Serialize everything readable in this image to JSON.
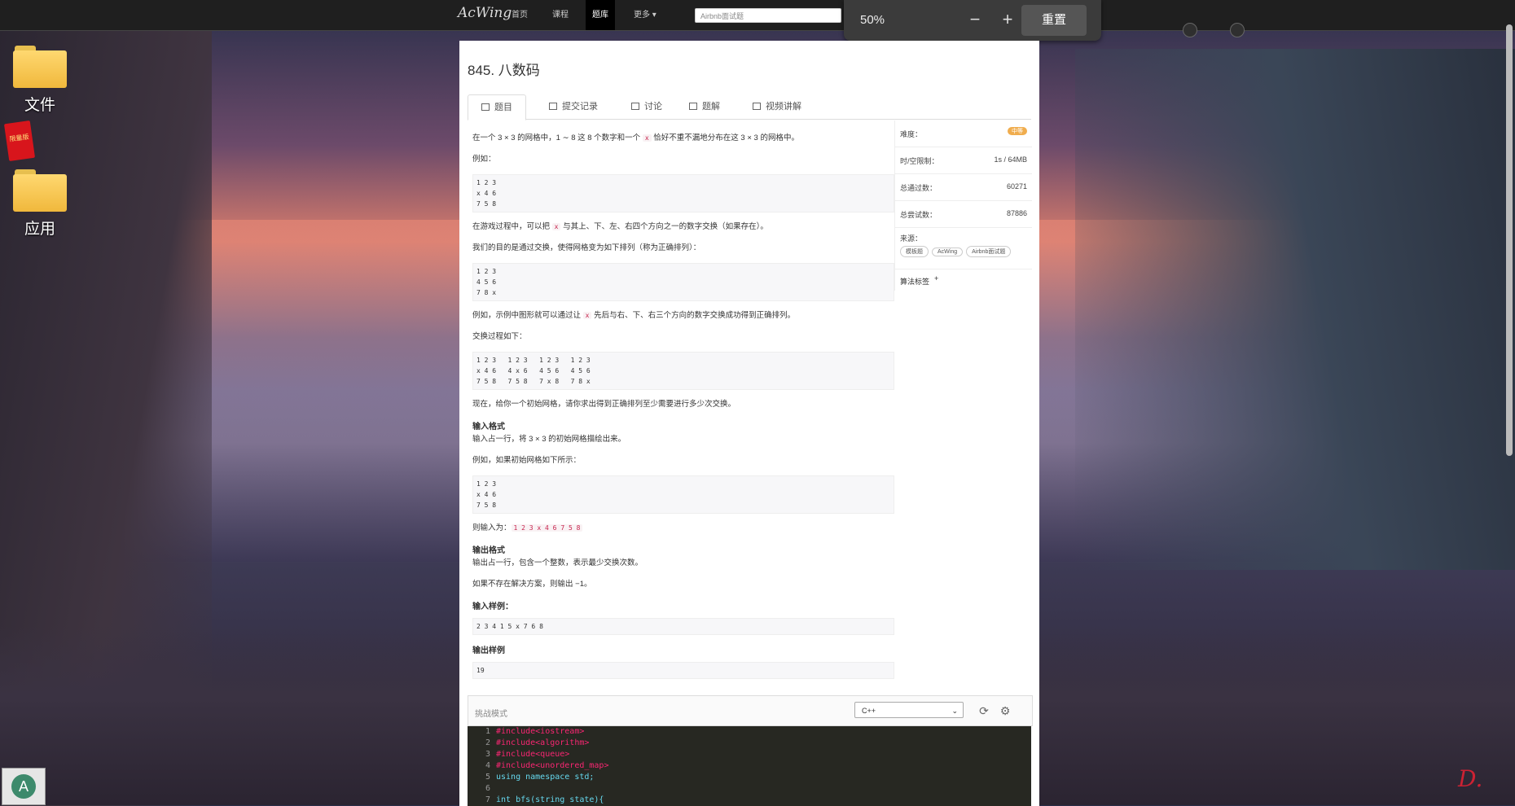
{
  "topbar": {
    "brand": "AcWing",
    "nav": [
      "首页",
      "课程",
      "题库",
      "更多"
    ],
    "search_placeholder": "Airbnb面试题"
  },
  "zoom": {
    "percent": "50%",
    "minus": "−",
    "plus": "+",
    "reset": "重置"
  },
  "desktop": {
    "folders": [
      "文件",
      "应用"
    ],
    "red_packet": "限量版"
  },
  "problem": {
    "title": "845. 八数码",
    "tabs": [
      "题目",
      "提交记录",
      "讨论",
      "题解",
      "视频讲解"
    ],
    "intro_a": "在一个 3 × 3 的网格中，1 ∼ 8 这 8 个数字和一个",
    "intro_x": "x",
    "intro_b": "恰好不重不漏地分布在这 3 × 3 的网格中。",
    "example_label": "例如：",
    "grid1": "1 2 3\nx 4 6\n7 5 8",
    "swap_a": "在游戏过程中，可以把",
    "swap_b": "与其上、下、左、右四个方向之一的数字交换（如果存在）。",
    "goal": "我们的目的是通过交换，使得网格变为如下排列（称为正确排列）：",
    "grid2": "1 2 3\n4 5 6\n7 8 x",
    "demo_a": "例如，示例中图形就可以通过让",
    "demo_b": "先后与右、下、右三个方向的数字交换成功得到正确排列。",
    "process": "交换过程如下：",
    "grid3": "1 2 3   1 2 3   1 2 3   1 2 3\nx 4 6   4 x 6   4 5 6   4 5 6\n7 5 8   7 5 8   7 x 8   7 8 x",
    "question": "现在，给你一个初始网格，请你求出得到正确排列至少需要进行多少次交换。",
    "input_title": "输入格式",
    "input_desc": "输入占一行，将 3 × 3 的初始网格描绘出来。",
    "input_example": "例如，如果初始网格如下所示：",
    "grid4": "1 2 3\nx 4 6\n7 5 8",
    "input_then": "则输入为：",
    "input_inline": "1 2 3 x 4 6 7 5 8",
    "output_title": "输出格式",
    "output_desc": "输出占一行，包含一个整数，表示最少交换次数。",
    "output_none": "如果不存在解决方案，则输出 −1。",
    "sample_in_title": "输入样例：",
    "sample_in": "2 3 4 1 5 x 7 6 8",
    "sample_out_title": "输出样例",
    "sample_out": "19"
  },
  "info": {
    "difficulty_label": "难度：",
    "difficulty": "中等",
    "limit_label": "时/空限制：",
    "limit": "1s / 64MB",
    "passed_label": "总通过数：",
    "passed": "60271",
    "tried_label": "总尝试数：",
    "tried": "87886",
    "source_label": "来源：",
    "sources": [
      "模板题",
      "AcWing",
      "Airbnb面试题"
    ],
    "algo_label": "算法标签"
  },
  "editor": {
    "mode": "挑战模式",
    "language": "C++",
    "lines": [
      {
        "n": "1",
        "code": "#include<iostream>"
      },
      {
        "n": "2",
        "code": "#include<algorithm>"
      },
      {
        "n": "3",
        "code": "#include<queue>"
      },
      {
        "n": "4",
        "code": "#include<unordered_map>"
      },
      {
        "n": "5",
        "code": "using namespace std;"
      },
      {
        "n": "6",
        "code": ""
      },
      {
        "n": "7",
        "code": "int bfs(string state){"
      }
    ]
  }
}
